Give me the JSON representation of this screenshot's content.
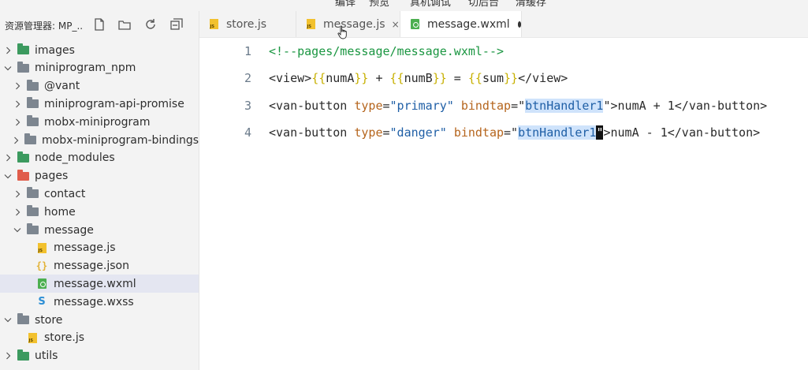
{
  "toolbar": {
    "items": [
      "编译",
      "预览",
      "真机调试",
      "切后台",
      "清缓存"
    ]
  },
  "explorer": {
    "title": "资源管理器: MP_...",
    "icons": [
      "new-file-icon",
      "new-folder-icon",
      "refresh-icon",
      "collapse-all-icon"
    ]
  },
  "tree": [
    {
      "label": "images",
      "icon": "folder-green",
      "chevron": "right",
      "depth": 0
    },
    {
      "label": "miniprogram_npm",
      "icon": "folder-gray",
      "chevron": "down",
      "depth": 0
    },
    {
      "label": "@vant",
      "icon": "folder-gray",
      "chevron": "right",
      "depth": 1
    },
    {
      "label": "miniprogram-api-promise",
      "icon": "folder-gray",
      "chevron": "right",
      "depth": 1
    },
    {
      "label": "mobx-miniprogram",
      "icon": "folder-gray",
      "chevron": "right",
      "depth": 1
    },
    {
      "label": "mobx-miniprogram-bindings",
      "icon": "folder-gray",
      "chevron": "right",
      "depth": 1
    },
    {
      "label": "node_modules",
      "icon": "folder-green",
      "chevron": "right",
      "depth": 0
    },
    {
      "label": "pages",
      "icon": "folder-red",
      "chevron": "down",
      "depth": 0
    },
    {
      "label": "contact",
      "icon": "folder-gray",
      "chevron": "right",
      "depth": 1
    },
    {
      "label": "home",
      "icon": "folder-gray",
      "chevron": "right",
      "depth": 1
    },
    {
      "label": "message",
      "icon": "folder-gray",
      "chevron": "down",
      "depth": 1
    },
    {
      "label": "message.js",
      "icon": "js-file",
      "chevron": "",
      "depth": 2
    },
    {
      "label": "message.json",
      "icon": "json-file",
      "chevron": "",
      "depth": 2
    },
    {
      "label": "message.wxml",
      "icon": "wxml-file",
      "chevron": "",
      "depth": 2,
      "selected": true
    },
    {
      "label": "message.wxss",
      "icon": "wxss-file",
      "chevron": "",
      "depth": 2
    },
    {
      "label": "store",
      "icon": "folder-gray",
      "chevron": "down",
      "depth": 0
    },
    {
      "label": "store.js",
      "icon": "js-file",
      "chevron": "",
      "depth": 1
    },
    {
      "label": "utils",
      "icon": "folder-green",
      "chevron": "right",
      "depth": 0
    }
  ],
  "tabs": [
    {
      "label": "store.js",
      "icon": "js-file",
      "active": false
    },
    {
      "label": "message.js",
      "icon": "js-file",
      "active": false,
      "close": "×"
    },
    {
      "label": "message.wxml",
      "icon": "wxml-file",
      "active": true,
      "modified": true
    }
  ],
  "editor": {
    "line_numbers": [
      "1",
      "2",
      "3",
      "4"
    ],
    "lines": [
      [
        {
          "t": "<!--pages/message/message.wxml-->",
          "c": "comment"
        }
      ],
      [
        {
          "t": "<view>",
          "c": "tag"
        },
        {
          "t": "{{",
          "c": "mus"
        },
        {
          "t": "numA",
          "c": "var"
        },
        {
          "t": "}}",
          "c": "mus"
        },
        {
          "t": " + ",
          "c": "text"
        },
        {
          "t": "{{",
          "c": "mus"
        },
        {
          "t": "numB",
          "c": "var"
        },
        {
          "t": "}}",
          "c": "mus"
        },
        {
          "t": " = ",
          "c": "text"
        },
        {
          "t": "{{",
          "c": "mus"
        },
        {
          "t": "sum",
          "c": "var"
        },
        {
          "t": "}}",
          "c": "mus"
        },
        {
          "t": "</view>",
          "c": "tag"
        }
      ],
      [
        {
          "t": "<van-button ",
          "c": "tag"
        },
        {
          "t": "type",
          "c": "attr"
        },
        {
          "t": "=",
          "c": "text"
        },
        {
          "t": "\"primary\"",
          "c": "str"
        },
        {
          "t": " ",
          "c": "text"
        },
        {
          "t": "bindtap",
          "c": "attr"
        },
        {
          "t": "=\"",
          "c": "text"
        },
        {
          "t": "btnHandler1",
          "c": "str",
          "hl": true
        },
        {
          "t": "\"",
          "c": "text"
        },
        {
          "t": ">numA + 1</van-button>",
          "c": "tag"
        }
      ],
      [
        {
          "t": "<van-button ",
          "c": "tag"
        },
        {
          "t": "type",
          "c": "attr"
        },
        {
          "t": "=",
          "c": "text"
        },
        {
          "t": "\"danger\"",
          "c": "str"
        },
        {
          "t": " ",
          "c": "text"
        },
        {
          "t": "bindtap",
          "c": "attr"
        },
        {
          "t": "=\"",
          "c": "text"
        },
        {
          "t": "btnHandler1",
          "c": "str",
          "hl": true
        },
        {
          "t": "\"",
          "c": "text",
          "cursor": true
        },
        {
          "t": ">numA - 1</van-button>",
          "c": "tag"
        }
      ]
    ]
  },
  "colors": {
    "sidebar_bg": "#f3f3f3",
    "selected_row": "#e4e6f1",
    "comment": "#1a9641",
    "string": "#1f5fa6",
    "attr": "#b5651d",
    "mustache": "#c7b000",
    "highlight": "#cfe3fb"
  }
}
